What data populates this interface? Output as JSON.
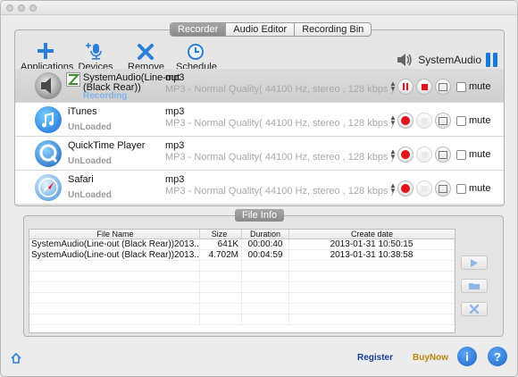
{
  "tabs": [
    {
      "label": "Recorder",
      "active": true
    },
    {
      "label": "Audio Editor",
      "active": false
    },
    {
      "label": "Recording Bin",
      "active": false
    }
  ],
  "toolbar": {
    "applications_label": "Applications",
    "devices_label": "Devices",
    "remove_label": "Remove",
    "schedule_label": "Schedule",
    "system_audio_label": "SystemAudio"
  },
  "sources": [
    {
      "name": "SystemAudio(Line-out (Black Rear))",
      "status": "Recording",
      "format": "mp3",
      "format_desc": "MP3 - Normal Quality( 44100 Hz, stereo , 128 kbps )",
      "mute_label": "mute",
      "icon": "speaker-icon"
    },
    {
      "name": "iTunes",
      "status": "UnLoaded",
      "format": "mp3",
      "format_desc": "MP3 - Normal Quality( 44100 Hz, stereo , 128 kbps )",
      "mute_label": "mute",
      "icon": "itunes-icon"
    },
    {
      "name": "QuickTime Player",
      "status": "UnLoaded",
      "format": "mp3",
      "format_desc": "MP3 - Normal Quality( 44100 Hz, stereo , 128 kbps )",
      "mute_label": "mute",
      "icon": "quicktime-icon"
    },
    {
      "name": "Safari",
      "status": "UnLoaded",
      "format": "mp3",
      "format_desc": "MP3 - Normal Quality( 44100 Hz, stereo , 128 kbps )",
      "mute_label": "mute",
      "icon": "safari-icon"
    }
  ],
  "file_info": {
    "title": "File Info",
    "columns": [
      "File Name",
      "Size",
      "Duration",
      "Create date"
    ],
    "rows": [
      {
        "name": "SystemAudio(Line-out (Black Rear))2013...",
        "size": "641K",
        "duration": "00:00:40",
        "date": "2013-01-31 10:50:15"
      },
      {
        "name": "SystemAudio(Line-out (Black Rear))2013...",
        "size": "4.702M",
        "duration": "00:04:59",
        "date": "2013-01-31 10:38:58"
      }
    ]
  },
  "footer": {
    "register_label": "Register",
    "buynow_label": "BuyNow",
    "info_label": "i",
    "help_label": "?"
  },
  "colors": {
    "accent": "#1a78d6",
    "record": "#e0141b",
    "recording_text": "#7fb3e8"
  }
}
